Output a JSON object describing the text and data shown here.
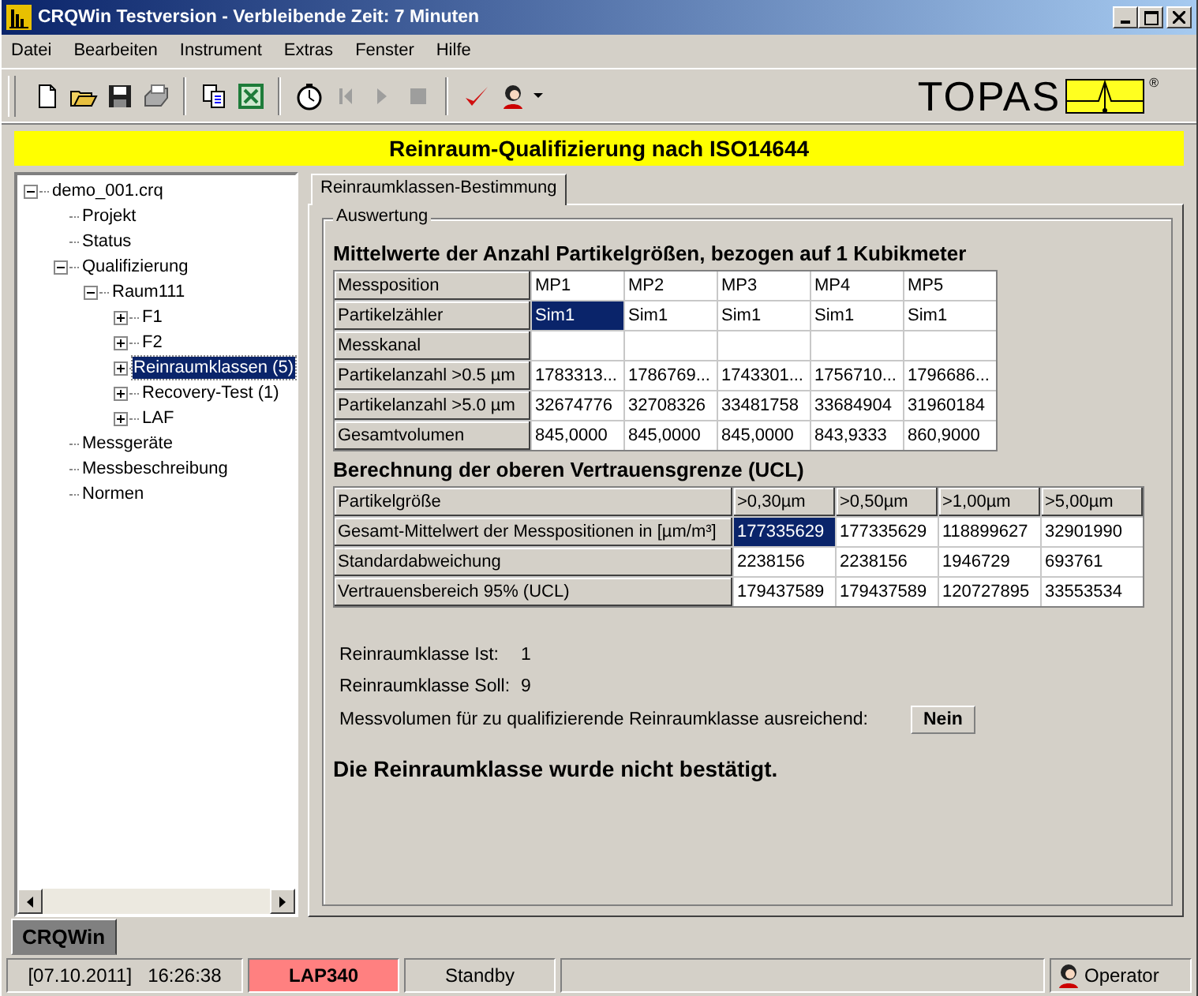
{
  "window": {
    "title": "CRQWin Testversion - Verbleibende Zeit: 7 Minuten"
  },
  "menu": [
    "Datei",
    "Bearbeiten",
    "Instrument",
    "Extras",
    "Fenster",
    "Hilfe"
  ],
  "toolbar": [
    {
      "kind": "new",
      "disabled": false
    },
    {
      "kind": "open",
      "disabled": false
    },
    {
      "kind": "save",
      "disabled": false
    },
    {
      "kind": "print",
      "disabled": false
    },
    {
      "kind": "sep"
    },
    {
      "kind": "copy",
      "disabled": false
    },
    {
      "kind": "excel",
      "disabled": false
    },
    {
      "kind": "sep"
    },
    {
      "kind": "timer",
      "disabled": false
    },
    {
      "kind": "first",
      "disabled": true
    },
    {
      "kind": "play",
      "disabled": true
    },
    {
      "kind": "stop",
      "disabled": true
    },
    {
      "kind": "sep"
    },
    {
      "kind": "check",
      "disabled": false
    },
    {
      "kind": "user",
      "disabled": false
    }
  ],
  "logo": {
    "text": "TOPAS",
    "mark": "®"
  },
  "banner": "Reinraum-Qualifizierung nach ISO14644",
  "tree": [
    {
      "label": "demo_001.crq",
      "expanded": true,
      "selected": false,
      "children": [
        {
          "label": "Projekt",
          "selected": false
        },
        {
          "label": "Status",
          "selected": false
        },
        {
          "label": "Qualifizierung",
          "expanded": true,
          "selected": false,
          "children": [
            {
              "label": "Raum111",
              "expanded": true,
              "selected": false,
              "children": [
                {
                  "label": "F1",
                  "expanded": false,
                  "selected": false
                },
                {
                  "label": "F2",
                  "expanded": false,
                  "selected": false
                },
                {
                  "label": "Reinraumklassen (5)",
                  "expanded": false,
                  "selected": true
                },
                {
                  "label": "Recovery-Test (1)",
                  "expanded": false,
                  "selected": false
                },
                {
                  "label": "LAF",
                  "expanded": false,
                  "selected": false
                }
              ]
            }
          ]
        },
        {
          "label": "Messgeräte",
          "selected": false
        },
        {
          "label": "Messbeschreibung",
          "selected": false
        },
        {
          "label": "Normen",
          "selected": false
        }
      ]
    }
  ],
  "tabs": [
    {
      "label": "Reinraumklassen-Bestimmung",
      "selected": true
    }
  ],
  "group_title": "Auswertung",
  "table1": {
    "title": "Mittelwerte der Anzahl Partikelgrößen, bezogen auf 1 Kubikmeter",
    "header": {
      "label": "Messposition",
      "columns": [
        "MP1",
        "MP2",
        "MP3",
        "MP4",
        "MP5"
      ]
    },
    "rows": [
      {
        "label": "Partikelzähler",
        "cells": [
          {
            "text": "Sim1",
            "selected": true
          },
          {
            "text": "Sim1",
            "selected": false
          },
          {
            "text": "Sim1",
            "selected": false
          },
          {
            "text": "Sim1",
            "selected": false
          },
          {
            "text": "Sim1",
            "selected": false
          }
        ]
      },
      {
        "label": "Messkanal",
        "cells": [
          {
            "selected": false
          },
          {
            "selected": false
          },
          {
            "selected": false
          },
          {
            "selected": false
          },
          {
            "selected": false
          }
        ]
      },
      {
        "label": "Partikelanzahl >0.5 µm",
        "cells": [
          {
            "text": "1783313...",
            "selected": false
          },
          {
            "text": "1786769...",
            "selected": false
          },
          {
            "text": "1743301...",
            "selected": false
          },
          {
            "text": "1756710...",
            "selected": false
          },
          {
            "text": "1796686...",
            "selected": false
          }
        ]
      },
      {
        "label": "Partikelanzahl >5.0 µm",
        "cells": [
          {
            "text": "32674776",
            "selected": false
          },
          {
            "text": "32708326",
            "selected": false
          },
          {
            "text": "33481758",
            "selected": false
          },
          {
            "text": "33684904",
            "selected": false
          },
          {
            "text": "31960184",
            "selected": false
          }
        ]
      },
      {
        "label": "Gesamtvolumen",
        "cells": [
          {
            "text": "845,0000",
            "selected": false
          },
          {
            "text": "845,0000",
            "selected": false
          },
          {
            "text": "845,0000",
            "selected": false
          },
          {
            "text": "843,9333",
            "selected": false
          },
          {
            "text": "860,9000",
            "selected": false
          }
        ]
      }
    ]
  },
  "table2": {
    "title": "Berechnung der oberen Vertrauensgrenze (UCL)",
    "header": {
      "label": "Partikelgröße",
      "columns": [
        ">0,30µm",
        ">0,50µm",
        ">1,00µm",
        ">5,00µm"
      ]
    },
    "rows": [
      {
        "label": "Gesamt-Mittelwert der Messpositionen in [µm/m³]",
        "cells": [
          {
            "text": "177335629",
            "selected": true
          },
          {
            "text": "177335629",
            "selected": false
          },
          {
            "text": "118899627",
            "selected": false
          },
          {
            "text": "32901990",
            "selected": false
          }
        ]
      },
      {
        "label": "Standardabweichung",
        "cells": [
          {
            "text": "2238156",
            "selected": false
          },
          {
            "text": "2238156",
            "selected": false
          },
          {
            "text": "1946729",
            "selected": false
          },
          {
            "text": "693761",
            "selected": false
          }
        ]
      },
      {
        "label": "Vertrauensbereich 95% (UCL)",
        "cells": [
          {
            "text": "179437589",
            "selected": false
          },
          {
            "text": "179437589",
            "selected": false
          },
          {
            "text": "120727895",
            "selected": false
          },
          {
            "text": "33553534",
            "selected": false
          }
        ]
      }
    ]
  },
  "results": [
    {
      "label": "Reinraumklasse Ist:",
      "value": "1"
    },
    {
      "label": "Reinraumklasse Soll:",
      "value": "9"
    }
  ],
  "volume": {
    "label": "Messvolumen für zu qualifizierende Reinraumklasse ausreichend:",
    "value": "Nein"
  },
  "conclusion": "Die Reinraumklasse wurde nicht bestätigt.",
  "bottom_tabs": [
    {
      "label": "CRQWin",
      "selected": true
    }
  ],
  "status_bar": [
    {
      "kind": "datetime",
      "date": "[07.10.2011]",
      "time": "16:26:38"
    },
    {
      "kind": "text",
      "text": "LAP340",
      "color": "#ff8080"
    },
    {
      "kind": "text",
      "text": "Standby"
    },
    {
      "kind": "empty"
    },
    {
      "kind": "user",
      "text": "Operator"
    }
  ]
}
